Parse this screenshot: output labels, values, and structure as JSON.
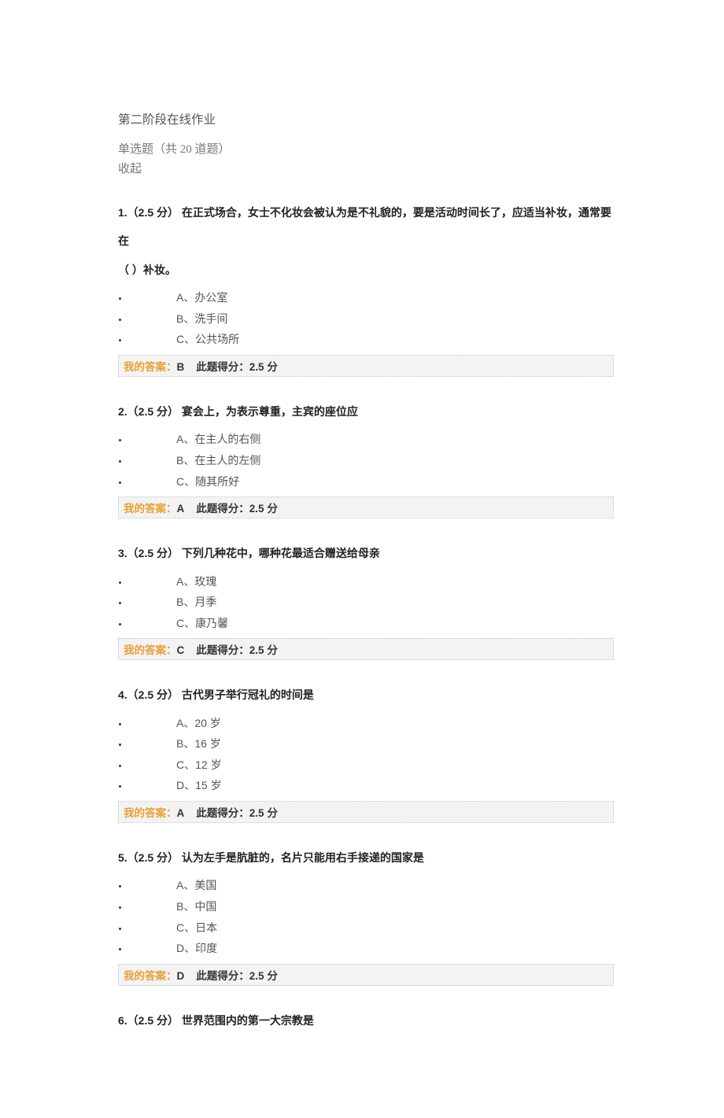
{
  "header": {
    "title": "第二阶段在线作业",
    "subtitle": "单选题（共 20 道题）",
    "collapse": "收起"
  },
  "answer_label": "我的答案：",
  "score_prefix": "此题得分：",
  "score_suffix": " 分",
  "questions": [
    {
      "num": "1.（2.5 分）",
      "text": " 在正式场合，女士不化妆会被认为是不礼貌的，要是活动时间长了，应适当补妆，通常要在",
      "text2": "（  ）补妆。",
      "options": [
        "A、办公室",
        "B、洗手间",
        "C、公共场所"
      ],
      "answer": "B",
      "score": "2.5"
    },
    {
      "num": "2.（2.5 分）",
      "text": " 宴会上，为表示尊重，主宾的座位应",
      "options": [
        "A、在主人的右侧",
        "B、在主人的左侧",
        "C、随其所好"
      ],
      "answer": "A",
      "score": "2.5"
    },
    {
      "num": "3.（2.5 分）",
      "text": " 下列几种花中，哪种花最适合赠送给母亲",
      "options": [
        "A、玫瑰",
        "B、月季",
        "C、康乃馨"
      ],
      "answer": "C",
      "score": "2.5"
    },
    {
      "num": "4.（2.5 分）",
      "text": " 古代男子举行冠礼的时间是",
      "options": [
        "A、20 岁",
        "B、16 岁",
        "C、12 岁",
        "D、15 岁"
      ],
      "answer": "A",
      "score": "2.5"
    },
    {
      "num": "5.（2.5 分）",
      "text": " 认为左手是肮脏的，名片只能用右手接递的国家是",
      "options": [
        "A、美国",
        "B、中国",
        "C、日本",
        "D、印度"
      ],
      "answer": "D",
      "score": "2.5"
    },
    {
      "num": "6.（2.5 分）",
      "text": " 世界范围内的第一大宗教是"
    }
  ]
}
